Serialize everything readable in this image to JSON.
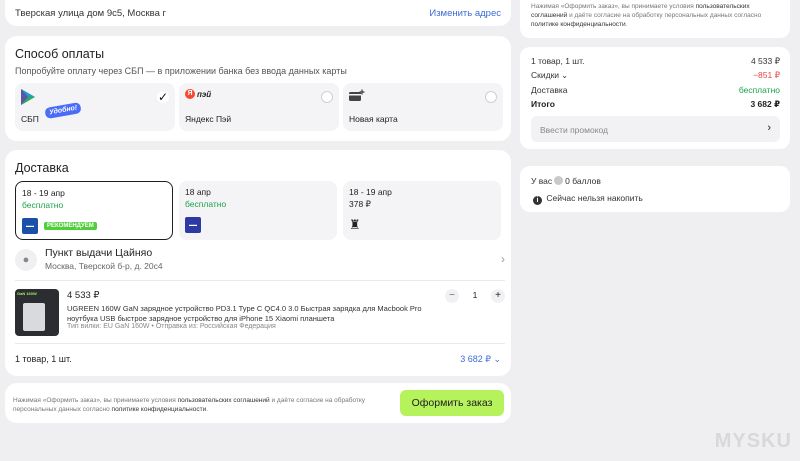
{
  "address": {
    "text": "Тверская улица дом 9с5, Москва г",
    "change_link": "Изменить адрес"
  },
  "payment": {
    "title": "Способ оплаты",
    "subtitle": "Попробуйте оплату через СБП — в приложении банка без ввода данных карты",
    "options": [
      {
        "label": "СБП",
        "badge": "Удобно!",
        "selected": true
      },
      {
        "label": "Яндекс Пэй",
        "brand": "пэй",
        "selected": false
      },
      {
        "label": "Новая карта",
        "selected": false
      }
    ]
  },
  "delivery": {
    "title": "Доставка",
    "options": [
      {
        "date": "18 - 19 апр",
        "price": "бесплатно",
        "badge": "РЕКОМЕНДУЕМ",
        "selected": true
      },
      {
        "date": "18 апр",
        "price": "бесплатно",
        "selected": false
      },
      {
        "date": "18 - 19 апр",
        "price": "378 ₽",
        "selected": false
      }
    ],
    "pickup": {
      "name": "Пункт выдачи Цайняо",
      "address": "Москва, Тверской б-р, д. 20с4"
    },
    "product": {
      "image_tag": "GaN 160W",
      "price": "4 533 ₽",
      "title": "UGREEN 160W GaN зарядное устройство PD3.1 Type C QC4.0 3.0 Быстрая зарядка для Macbook Pro ноутбука USB быстрое зарядное устройство для iPhone 15 Xiaomi планшета",
      "meta": "Тип вилки: EU GaN 160W • Отправка из: Российская Федерация",
      "qty": "1",
      "minus": "−",
      "plus": "+"
    },
    "summary_label": "1 товар, 1 шт.",
    "summary_price": "3 682 ₽"
  },
  "bottom": {
    "note_1": "Нажимая «Оформить заказ», вы принимаете условия ",
    "note_link1": "пользовательских соглашений",
    "note_2": " и даёте согласие на обработку персональных данных согласно ",
    "note_link2": "политике конфиденциальности",
    "note_3": ".",
    "order_button": "Оформить заказ"
  },
  "right": {
    "note_1": "Нажимая «Оформить заказ», вы принимаете условия ",
    "note_link1": "пользовательских соглашений",
    "note_2": " и даёте согласие на обработку персональных данных согласно ",
    "note_link2": "политике конфиденциальности",
    "note_3": ".",
    "items_label": "1 товар, 1 шт.",
    "items_value": "4 533 ₽",
    "discounts_label": "Скидки",
    "discounts_value": "−851 ₽",
    "delivery_label": "Доставка",
    "delivery_value": "бесплатно",
    "total_label": "Итого",
    "total_value": "3 682 ₽",
    "promo_placeholder": "Ввести промокод",
    "points_1": "У вас",
    "points_2": "0 баллов",
    "points_info": "Сейчас нельзя накопить"
  },
  "colors": {
    "accent_green": "#b5f25b",
    "link_blue": "#3d6bd8",
    "free_green": "#1aa34a",
    "discount_red": "#e5484d"
  },
  "watermark": "MYSKU"
}
